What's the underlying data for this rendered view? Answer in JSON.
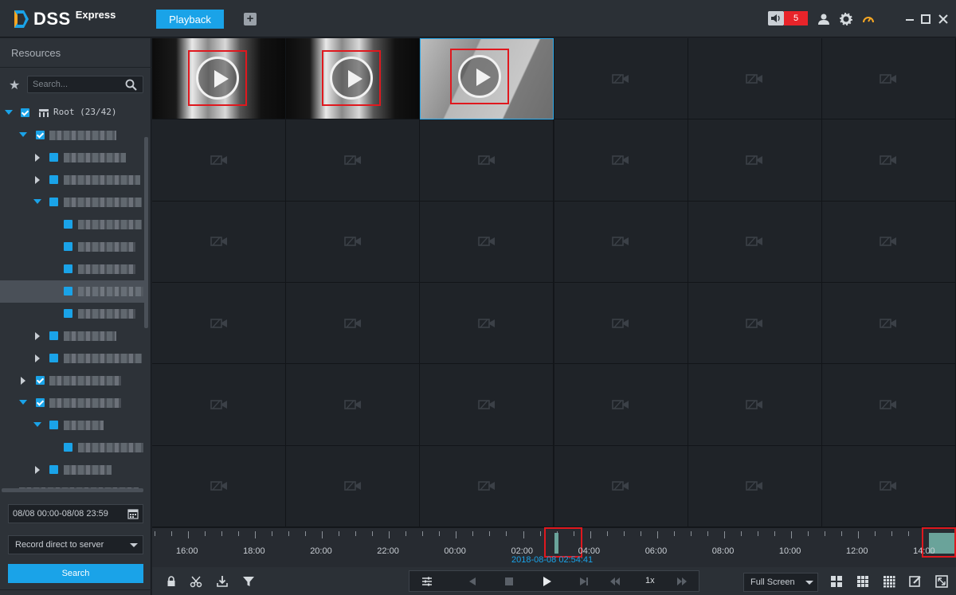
{
  "app": {
    "brand": "DSS",
    "edition": "Express"
  },
  "tabs": [
    {
      "label": "Playback",
      "active": true
    }
  ],
  "header": {
    "alarm_count": "5"
  },
  "sidebar": {
    "title": "Resources",
    "search_placeholder": "Search...",
    "root_label": "Root (23/42)",
    "date_range": "08/08 00:00-08/08 23:59",
    "record_source": "Record direct to server",
    "search_button": "Search"
  },
  "timeline": {
    "labels": [
      "16:00",
      "18:00",
      "20:00",
      "22:00",
      "00:00",
      "02:00",
      "04:00",
      "06:00",
      "08:00",
      "10:00",
      "12:00",
      "14:00"
    ],
    "cursor_time": "2018-08-08 02:54:41"
  },
  "controls": {
    "speed": "1x",
    "window_mode": "Full Screen"
  },
  "colors": {
    "accent": "#1aa3e8",
    "alarm": "#e8242a",
    "highlight": "#e0181e",
    "record": "#6aa39a"
  }
}
